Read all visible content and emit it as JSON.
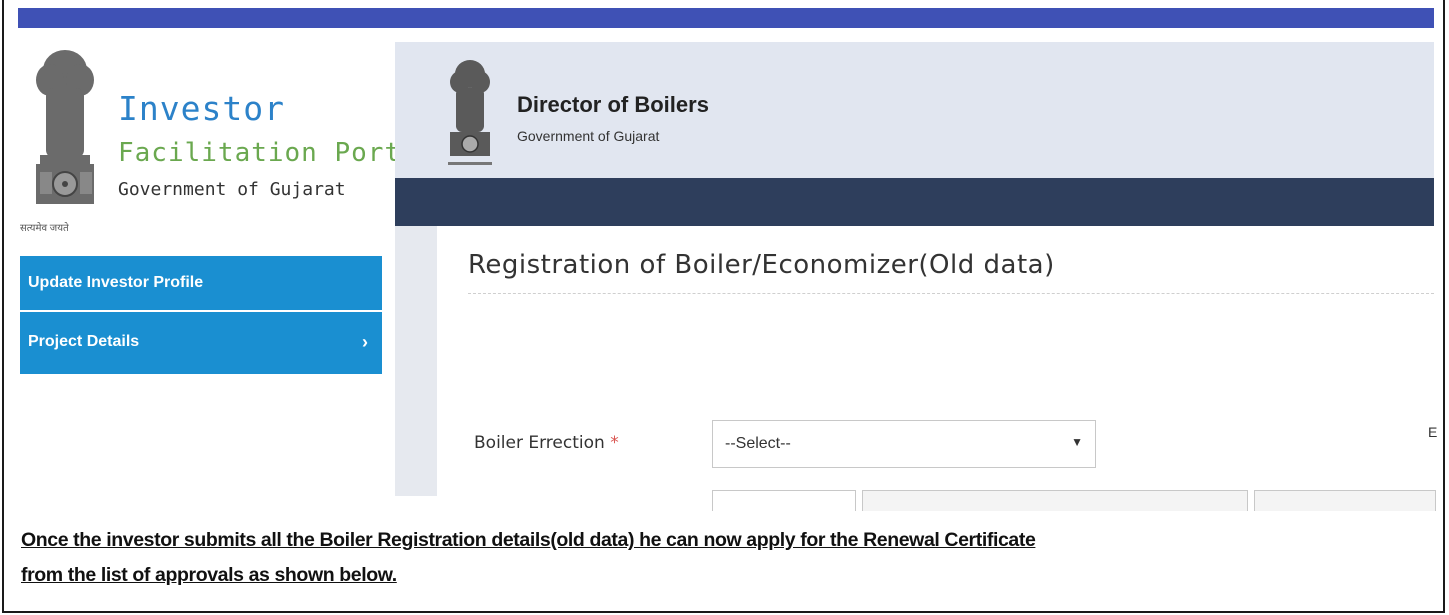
{
  "logo": {
    "line1": "Investor",
    "line2": "Facilitation Portal",
    "line3": "Government of Gujarat",
    "motto": "सत्यमेव जयते"
  },
  "sidebar": {
    "items": [
      {
        "label": "Update Investor Profile"
      },
      {
        "label": "Project Details",
        "chevron": "›"
      }
    ]
  },
  "header": {
    "title": "Director of Boilers",
    "subtitle": "Government of Gujarat"
  },
  "page": {
    "heading": "Registration of Boiler/Economizer(Old data)"
  },
  "form": {
    "boiler_erection": {
      "label": "Boiler Errection",
      "required_marker": "*",
      "value": "--Select--",
      "arrow": "▼"
    },
    "edge_char": "E"
  },
  "caption": {
    "line1": "Once the investor submits all the Boiler Registration details(old data) he can now apply for the Renewal Certificate",
    "line2": "from the list of approvals as shown below."
  },
  "colors": {
    "top_bar": "#3f51b5",
    "menu": "#1a8fd1",
    "dark_band": "#2e3e5c",
    "header_panel": "#e1e6f0",
    "logo_blue": "#2c82c9",
    "logo_green": "#6aa84f"
  }
}
